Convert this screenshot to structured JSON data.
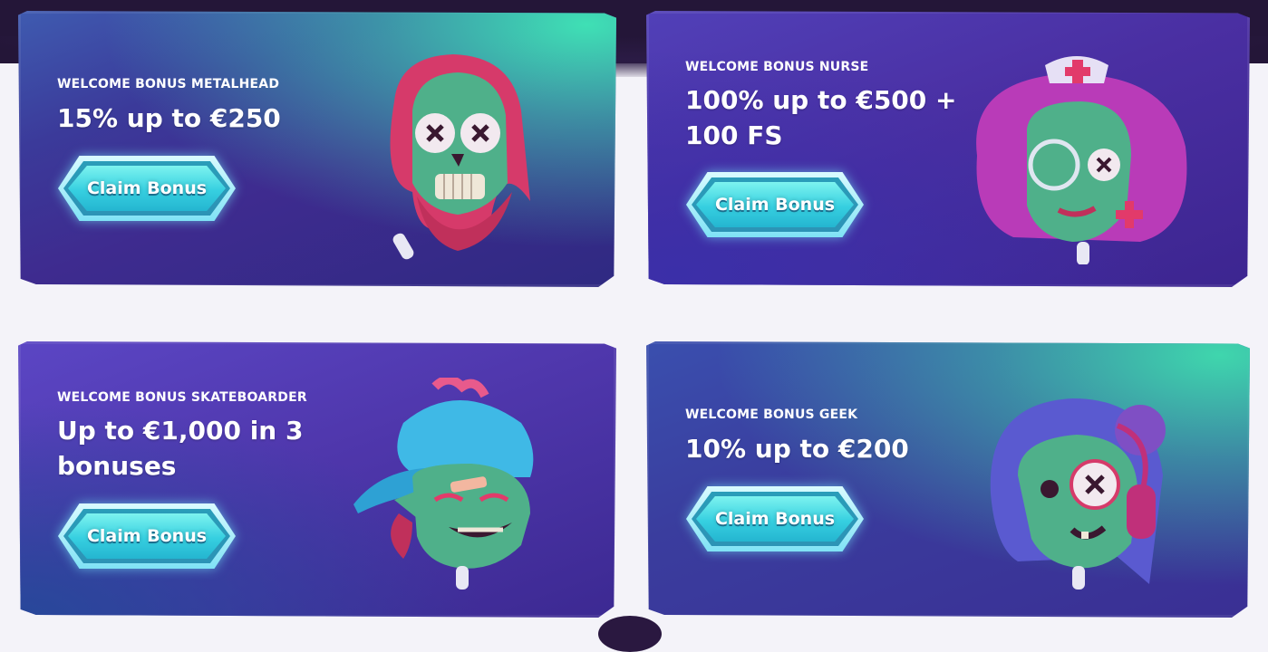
{
  "cards": [
    {
      "eyebrow": "WELCOME BONUS METALHEAD",
      "headline": "15% up to €250",
      "button_label": "Claim Bonus",
      "character": "metalhead-zombie"
    },
    {
      "eyebrow": "WELCOME BONUS NURSE",
      "headline": "100% up to €500 + 100 FS",
      "button_label": "Claim Bonus",
      "character": "nurse-zombie"
    },
    {
      "eyebrow": "WELCOME BONUS SKATEBOARDER",
      "headline": "Up to €1,000 in 3 bonuses",
      "button_label": "Claim Bonus",
      "character": "skateboarder-zombie"
    },
    {
      "eyebrow": "WELCOME BONUS GEEK",
      "headline": "10% up to €200",
      "button_label": "Claim Bonus",
      "character": "geek-zombie"
    }
  ],
  "colors": {
    "page_background": "#f4f3f9",
    "card_purple": "#3e2b8f",
    "card_teal_glow": "#3fe0b5",
    "button_cyan": "#36cfe0"
  }
}
